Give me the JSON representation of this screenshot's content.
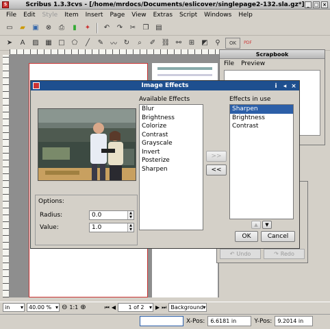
{
  "window": {
    "title": "Scribus 1.3.3cvs - [/home/mrdocs/Documents/eslicover/singlepage2-132.sla.gz*]"
  },
  "menu": [
    "File",
    "Edit",
    "Style",
    "Item",
    "Insert",
    "Page",
    "View",
    "Extras",
    "Script",
    "Windows",
    "Help"
  ],
  "toolbar1_icons": [
    "new-icon",
    "open-icon",
    "save-icon",
    "close-icon",
    "print-icon",
    "pdf-icon",
    "undo-icon",
    "redo-icon",
    "cut-icon",
    "copy-icon",
    "paste-icon"
  ],
  "toolbar2_icons": [
    "select-icon",
    "text-frame-icon",
    "image-frame-icon",
    "table-icon",
    "shape-icon",
    "polygon-icon",
    "line-icon",
    "bezier-icon",
    "freehand-icon",
    "rotate-icon",
    "zoom-icon",
    "edit-text-icon",
    "link-icon",
    "unlink-icon",
    "measure-icon",
    "copy-props-icon",
    "eyedropper-icon",
    "ok-icon",
    "pdf-tools-icon"
  ],
  "scrapbook": {
    "title": "Scrapbook",
    "menu": [
      "File",
      "Preview"
    ]
  },
  "undo_panel": {
    "undo_label": "Undo",
    "redo_label": "Redo"
  },
  "dialog": {
    "title": "Image Effects",
    "available_label": "Available Effects",
    "available": [
      "Blur",
      "Brightness",
      "Colorize",
      "Contrast",
      "Grayscale",
      "Invert",
      "Posterize",
      "Sharpen"
    ],
    "inuse_label": "Effects in use",
    "inuse": [
      "Sharpen",
      "Brightness",
      "Contrast"
    ],
    "inuse_selected": "Sharpen",
    "add_btn": ">>",
    "remove_btn": "<<",
    "options_label": "Options:",
    "radius_label": "Radius:",
    "radius_value": "0.0",
    "value_label": "Value:",
    "value_value": "1.0",
    "ok": "OK",
    "cancel": "Cancel"
  },
  "bottombar": {
    "unit": "in",
    "zoom": "40.00 %",
    "ratio": "1:1",
    "page": "1 of 2",
    "layer": "Background"
  },
  "status": {
    "xpos_label": "X-Pos:",
    "xpos": "6.6181 in",
    "ypos_label": "Y-Pos:",
    "ypos": "9.2014 in"
  },
  "colors": {
    "dialog_title": "#1e4f8f",
    "selection": "#2c5fa8",
    "page_border": "#cc3333"
  }
}
